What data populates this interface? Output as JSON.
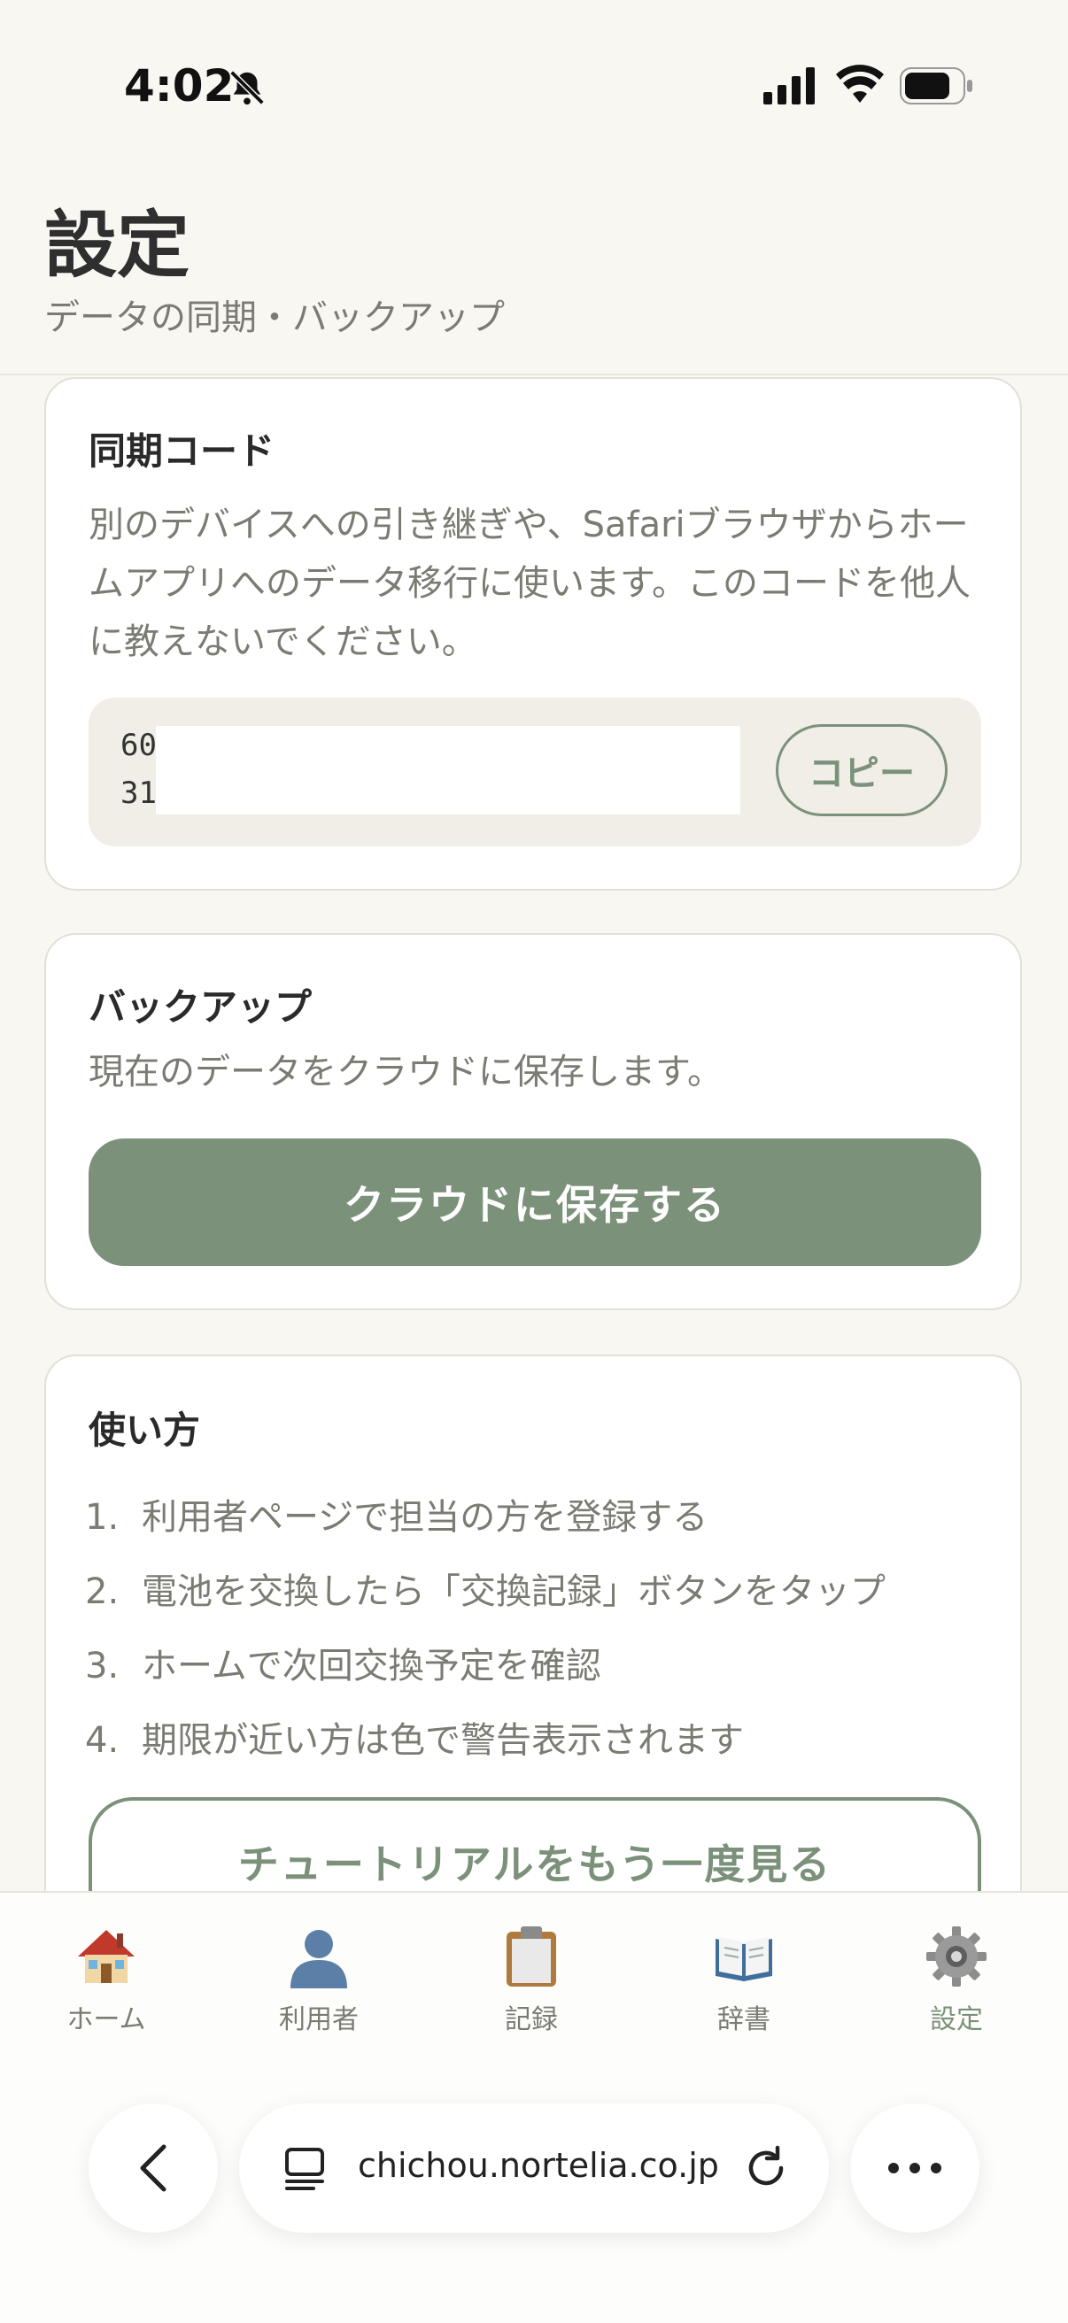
{
  "status_bar": {
    "time": "4:02"
  },
  "header": {
    "title": "設定",
    "subtitle": "データの同期・バックアップ"
  },
  "sync_card": {
    "title": "同期コード",
    "description": "別のデバイスへの引き継ぎや、Safariブラウザからホームアプリへのデータ移行に使います。このコードを他人に教えないでください。",
    "code_line_1": "60",
    "code_line_2": "31",
    "copy_label": "コピー"
  },
  "backup_card": {
    "title": "バックアップ",
    "description": "現在のデータをクラウドに保存します。",
    "save_label": "クラウドに保存する"
  },
  "howto_card": {
    "title": "使い方",
    "steps": [
      {
        "num": "1.",
        "text": "利用者ページで担当の方を登録する"
      },
      {
        "num": "2.",
        "text": "電池を交換したら「交換記録」ボタンをタップ"
      },
      {
        "num": "3.",
        "text": "ホームで次回交換予定を確認"
      },
      {
        "num": "4.",
        "text": "期限が近い方は色で警告表示されます"
      }
    ],
    "tutorial_label": "チュートリアルをもう一度見る"
  },
  "tab_bar": {
    "items": [
      {
        "label": "ホーム",
        "icon": "house-icon"
      },
      {
        "label": "利用者",
        "icon": "person-icon"
      },
      {
        "label": "記録",
        "icon": "clipboard-icon"
      },
      {
        "label": "辞書",
        "icon": "book-icon"
      },
      {
        "label": "設定",
        "icon": "gear-icon"
      }
    ],
    "active_index": 4,
    "active_color": "#7b917a"
  },
  "browser": {
    "url": "chichou.nortelia.co.jp"
  },
  "colors": {
    "accent": "#7b917a",
    "background": "#f8f7f2",
    "card": "#ffffff"
  }
}
